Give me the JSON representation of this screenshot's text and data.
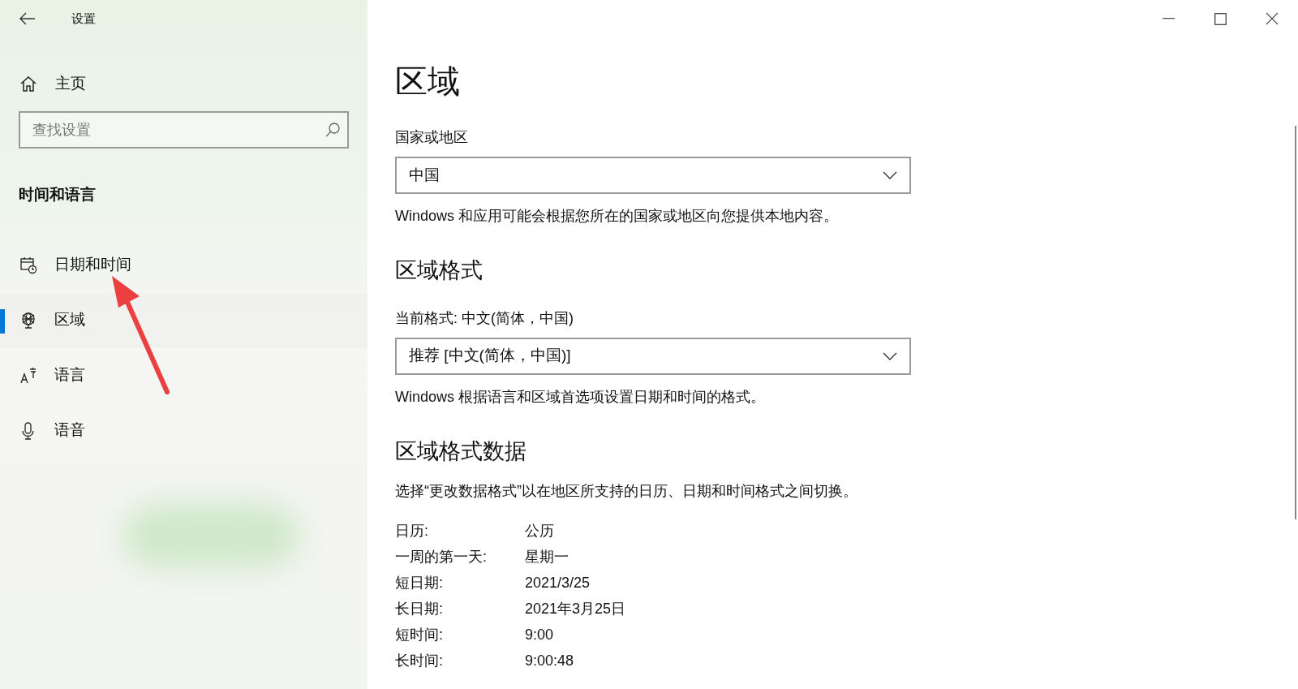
{
  "window": {
    "title": "设置"
  },
  "sidebar": {
    "home": "主页",
    "search": {
      "placeholder": "查找设置"
    },
    "section": "时间和语言",
    "items": [
      {
        "label": "日期和时间",
        "selected": false
      },
      {
        "label": "区域",
        "selected": true
      },
      {
        "label": "语言",
        "selected": false
      },
      {
        "label": "语音",
        "selected": false
      }
    ]
  },
  "main": {
    "title": "区域",
    "country": {
      "label": "国家或地区",
      "value": "中国",
      "hint": "Windows 和应用可能会根据您所在的国家或地区向您提供本地内容。"
    },
    "format_heading": "区域格式",
    "format": {
      "label": "当前格式: 中文(简体，中国)",
      "value": "推荐 [中文(简体，中国)]",
      "hint": "Windows 根据语言和区域首选项设置日期和时间的格式。"
    },
    "data_heading": "区域格式数据",
    "data_hint": "选择“更改数据格式”以在地区所支持的日历、日期和时间格式之间切换。",
    "rows": [
      {
        "label": "日历:",
        "value": "公历"
      },
      {
        "label": "一周的第一天:",
        "value": "星期一"
      },
      {
        "label": "短日期:",
        "value": "2021/3/25"
      },
      {
        "label": "长日期:",
        "value": "2021年3月25日"
      },
      {
        "label": "短时间:",
        "value": "9:00"
      },
      {
        "label": "长时间:",
        "value": "9:00:48"
      }
    ]
  }
}
